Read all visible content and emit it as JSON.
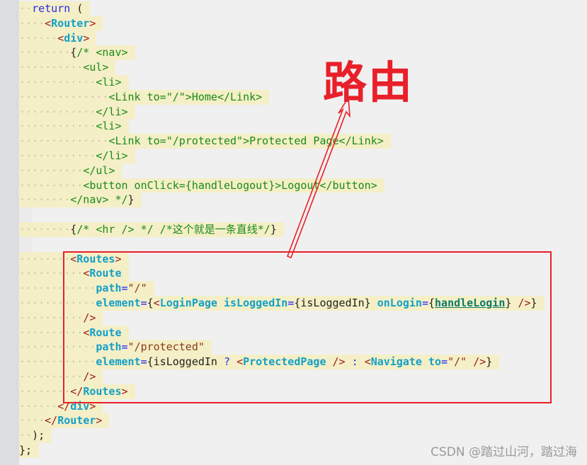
{
  "editor": {
    "lines": [
      {
        "indent": 2,
        "tokens": [
          [
            "kw",
            "return"
          ],
          [
            "pl",
            " ("
          ]
        ]
      },
      {
        "indent": 4,
        "tokens": [
          [
            "br",
            "<"
          ],
          [
            "tag",
            "Router"
          ],
          [
            "br",
            ">"
          ]
        ]
      },
      {
        "indent": 6,
        "tokens": [
          [
            "br",
            "<"
          ],
          [
            "tag",
            "div"
          ],
          [
            "br",
            ">"
          ]
        ]
      },
      {
        "indent": 8,
        "tokens": [
          [
            "pl",
            "{"
          ],
          [
            "cm",
            "/* <nav>"
          ]
        ]
      },
      {
        "indent": 10,
        "tokens": [
          [
            "cm",
            "<ul>"
          ]
        ]
      },
      {
        "indent": 12,
        "tokens": [
          [
            "cm",
            "<li>"
          ]
        ]
      },
      {
        "indent": 14,
        "tokens": [
          [
            "cm",
            "<Link to=\"/\">Home</Link>"
          ]
        ]
      },
      {
        "indent": 12,
        "tokens": [
          [
            "cm",
            "</li>"
          ]
        ]
      },
      {
        "indent": 12,
        "tokens": [
          [
            "cm",
            "<li>"
          ]
        ]
      },
      {
        "indent": 14,
        "tokens": [
          [
            "cm",
            "<Link to=\"/protected\">Protected Page</Link>"
          ]
        ]
      },
      {
        "indent": 12,
        "tokens": [
          [
            "cm",
            "</li>"
          ]
        ]
      },
      {
        "indent": 10,
        "tokens": [
          [
            "cm",
            "</ul>"
          ]
        ]
      },
      {
        "indent": 10,
        "tokens": [
          [
            "cm",
            "<button onClick={handleLogout}>Logout</button>"
          ]
        ]
      },
      {
        "indent": 8,
        "tokens": [
          [
            "cm",
            "</nav> */"
          ],
          [
            "pl",
            "}"
          ]
        ]
      },
      {
        "indent": 0,
        "tokens": []
      },
      {
        "indent": 8,
        "tokens": [
          [
            "pl",
            "{"
          ],
          [
            "cm",
            "/* <hr /> */ /*这个就是一条直线*/"
          ],
          [
            "pl",
            "}"
          ]
        ]
      },
      {
        "indent": 0,
        "tokens": []
      },
      {
        "indent": 8,
        "tokens": [
          [
            "br",
            "<"
          ],
          [
            "tag",
            "Routes"
          ],
          [
            "br",
            ">"
          ]
        ]
      },
      {
        "indent": 10,
        "tokens": [
          [
            "br",
            "<"
          ],
          [
            "tag",
            "Route"
          ]
        ]
      },
      {
        "indent": 12,
        "tokens": [
          [
            "attr",
            "path"
          ],
          [
            "eq",
            "="
          ],
          [
            "str",
            "\"/\""
          ]
        ]
      },
      {
        "indent": 12,
        "tokens": [
          [
            "attr",
            "element"
          ],
          [
            "eq",
            "="
          ],
          [
            "pl",
            "{"
          ],
          [
            "br",
            "<"
          ],
          [
            "tag",
            "LoginPage"
          ],
          [
            "pl",
            " "
          ],
          [
            "attr",
            "isLoggedIn"
          ],
          [
            "eq",
            "="
          ],
          [
            "pl",
            "{isLoggedIn} "
          ],
          [
            "attr",
            "onLogin"
          ],
          [
            "eq",
            "="
          ],
          [
            "pl",
            "{"
          ],
          [
            "fn",
            "handleLogin"
          ],
          [
            "pl",
            "} "
          ],
          [
            "br",
            "/>"
          ],
          [
            "pl",
            "}"
          ]
        ]
      },
      {
        "indent": 10,
        "tokens": [
          [
            "br",
            "/>"
          ]
        ]
      },
      {
        "indent": 10,
        "tokens": [
          [
            "br",
            "<"
          ],
          [
            "tag",
            "Route"
          ]
        ]
      },
      {
        "indent": 12,
        "tokens": [
          [
            "attr",
            "path"
          ],
          [
            "eq",
            "="
          ],
          [
            "str",
            "\"/protected\""
          ]
        ]
      },
      {
        "indent": 12,
        "tokens": [
          [
            "attr",
            "element"
          ],
          [
            "eq",
            "="
          ],
          [
            "pl",
            "{isLoggedIn "
          ],
          [
            "kw",
            "?"
          ],
          [
            "pl",
            " "
          ],
          [
            "br",
            "<"
          ],
          [
            "tag",
            "ProtectedPage"
          ],
          [
            "pl",
            " "
          ],
          [
            "br",
            "/>"
          ],
          [
            "pl",
            " "
          ],
          [
            "kw",
            ":"
          ],
          [
            "pl",
            " "
          ],
          [
            "br",
            "<"
          ],
          [
            "tag",
            "Navigate"
          ],
          [
            "pl",
            " "
          ],
          [
            "attr",
            "to"
          ],
          [
            "eq",
            "="
          ],
          [
            "str",
            "\"/\""
          ],
          [
            "pl",
            " "
          ],
          [
            "br",
            "/>"
          ],
          [
            "pl",
            "}"
          ]
        ]
      },
      {
        "indent": 10,
        "tokens": [
          [
            "br",
            "/>"
          ]
        ]
      },
      {
        "indent": 8,
        "tokens": [
          [
            "br",
            "</"
          ],
          [
            "tag",
            "Routes"
          ],
          [
            "br",
            ">"
          ]
        ]
      },
      {
        "indent": 6,
        "tokens": [
          [
            "br",
            "</"
          ],
          [
            "tag",
            "div"
          ],
          [
            "br",
            ">"
          ]
        ]
      },
      {
        "indent": 4,
        "tokens": [
          [
            "br",
            "</"
          ],
          [
            "tag",
            "Router"
          ],
          [
            "br",
            ">"
          ]
        ]
      },
      {
        "indent": 2,
        "tokens": [
          [
            "pl",
            ");"
          ]
        ]
      },
      {
        "indent": 0,
        "tokens": [
          [
            "pl",
            "};"
          ]
        ]
      }
    ]
  },
  "annotation": {
    "label": "路由",
    "color": "#e8202a"
  },
  "watermark": "CSDN @踏过山河，踏过海"
}
